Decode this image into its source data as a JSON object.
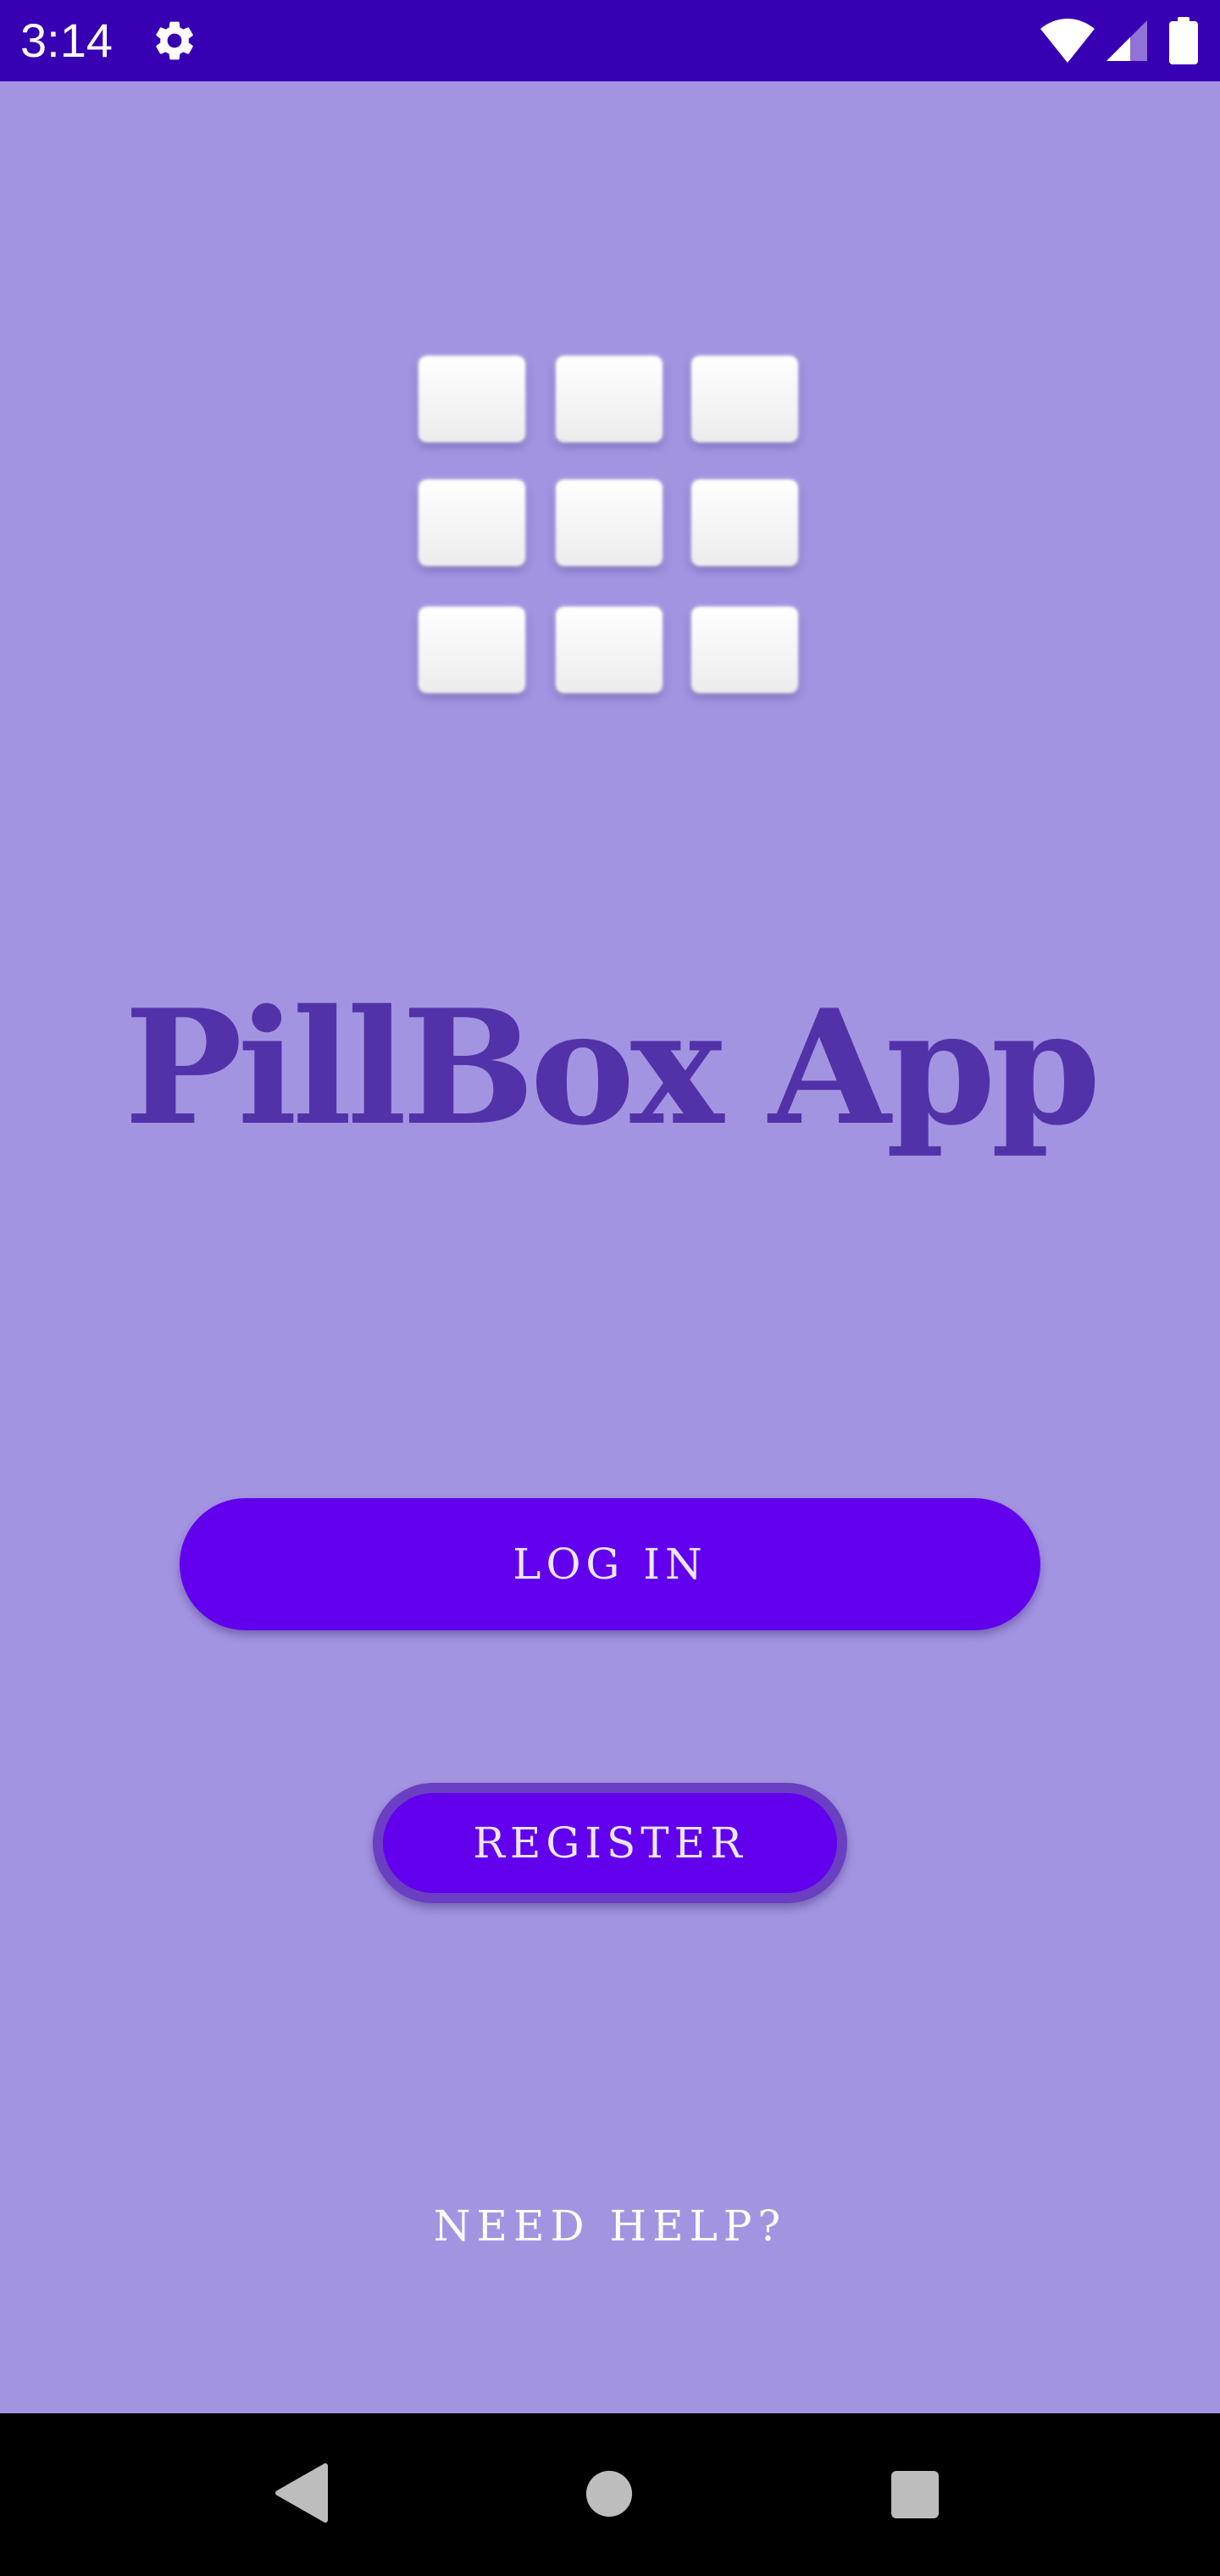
{
  "status_bar": {
    "time": "3:14",
    "icons": [
      "gear-icon",
      "wifi-icon",
      "cell-signal-icon",
      "battery-icon"
    ],
    "background": "#3700b3"
  },
  "logo": {
    "icon": "pill-grid-icon",
    "rows": 3,
    "columns": 3
  },
  "main": {
    "title": "PillBox App",
    "login_label": "LOG IN",
    "register_label": "REGISTER",
    "help_label": "NEED HELP?"
  },
  "colors": {
    "background": "#a394e2",
    "primary": "#6200ee",
    "primary_dark": "#3700b3",
    "title": "#5232a8",
    "register_outline": "#6a3fc2"
  },
  "nav_bar": {
    "icons": [
      "back-icon",
      "home-icon",
      "recents-icon"
    ]
  }
}
